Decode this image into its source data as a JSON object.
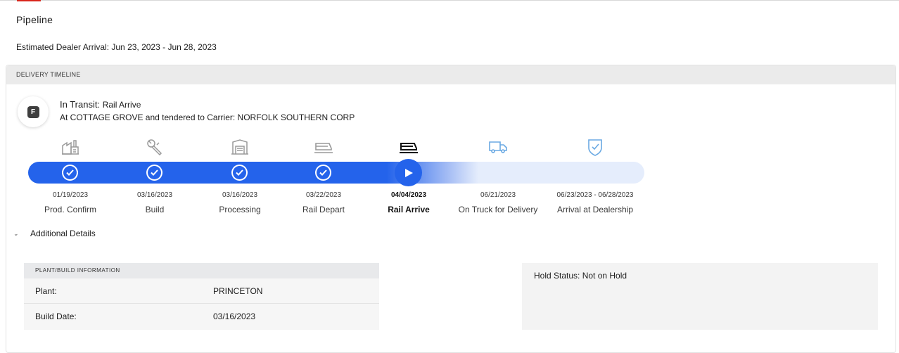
{
  "page": {
    "title": "Pipeline",
    "estimated_arrival": "Estimated Dealer Arrival: Jun 23, 2023 - Jun 28, 2023"
  },
  "timeline": {
    "header": "DELIVERY TIMELINE",
    "badge": "F",
    "status_prefix": "In Transit:",
    "status_detail": "Rail Arrive",
    "status_location": "At COTTAGE GROVE and tendered to Carrier: NORFOLK SOUTHERN CORP",
    "steps": [
      {
        "date": "01/19/2023",
        "label": "Prod. Confirm",
        "icon": "factory-icon",
        "state": "complete"
      },
      {
        "date": "03/16/2023",
        "label": "Build",
        "icon": "wrench-icon",
        "state": "complete"
      },
      {
        "date": "03/16/2023",
        "label": "Processing",
        "icon": "processing-icon",
        "state": "complete"
      },
      {
        "date": "03/22/2023",
        "label": "Rail Depart",
        "icon": "rail-icon",
        "state": "complete"
      },
      {
        "date": "04/04/2023",
        "label": "Rail Arrive",
        "icon": "rail-icon",
        "state": "current"
      },
      {
        "date": "06/21/2023",
        "label": "On Truck for Delivery",
        "icon": "truck-icon",
        "state": "upcoming"
      },
      {
        "date": "06/23/2023 - 06/28/2023",
        "label": "Arrival at Dealership",
        "icon": "shield-check-icon",
        "state": "upcoming"
      }
    ]
  },
  "additional_details": {
    "toggle_label": "Additional Details",
    "plant_panel": {
      "header": "PLANT/BUILD INFORMATION",
      "rows": [
        {
          "label": "Plant:",
          "value": "PRINCETON"
        },
        {
          "label": "Build Date:",
          "value": "03/16/2023"
        }
      ]
    },
    "hold_status": "Hold Status: Not on Hold"
  },
  "colors": {
    "accent": "#2463eb",
    "brand_red": "#d9261c",
    "upcoming_icon": "#6aa9e3"
  }
}
